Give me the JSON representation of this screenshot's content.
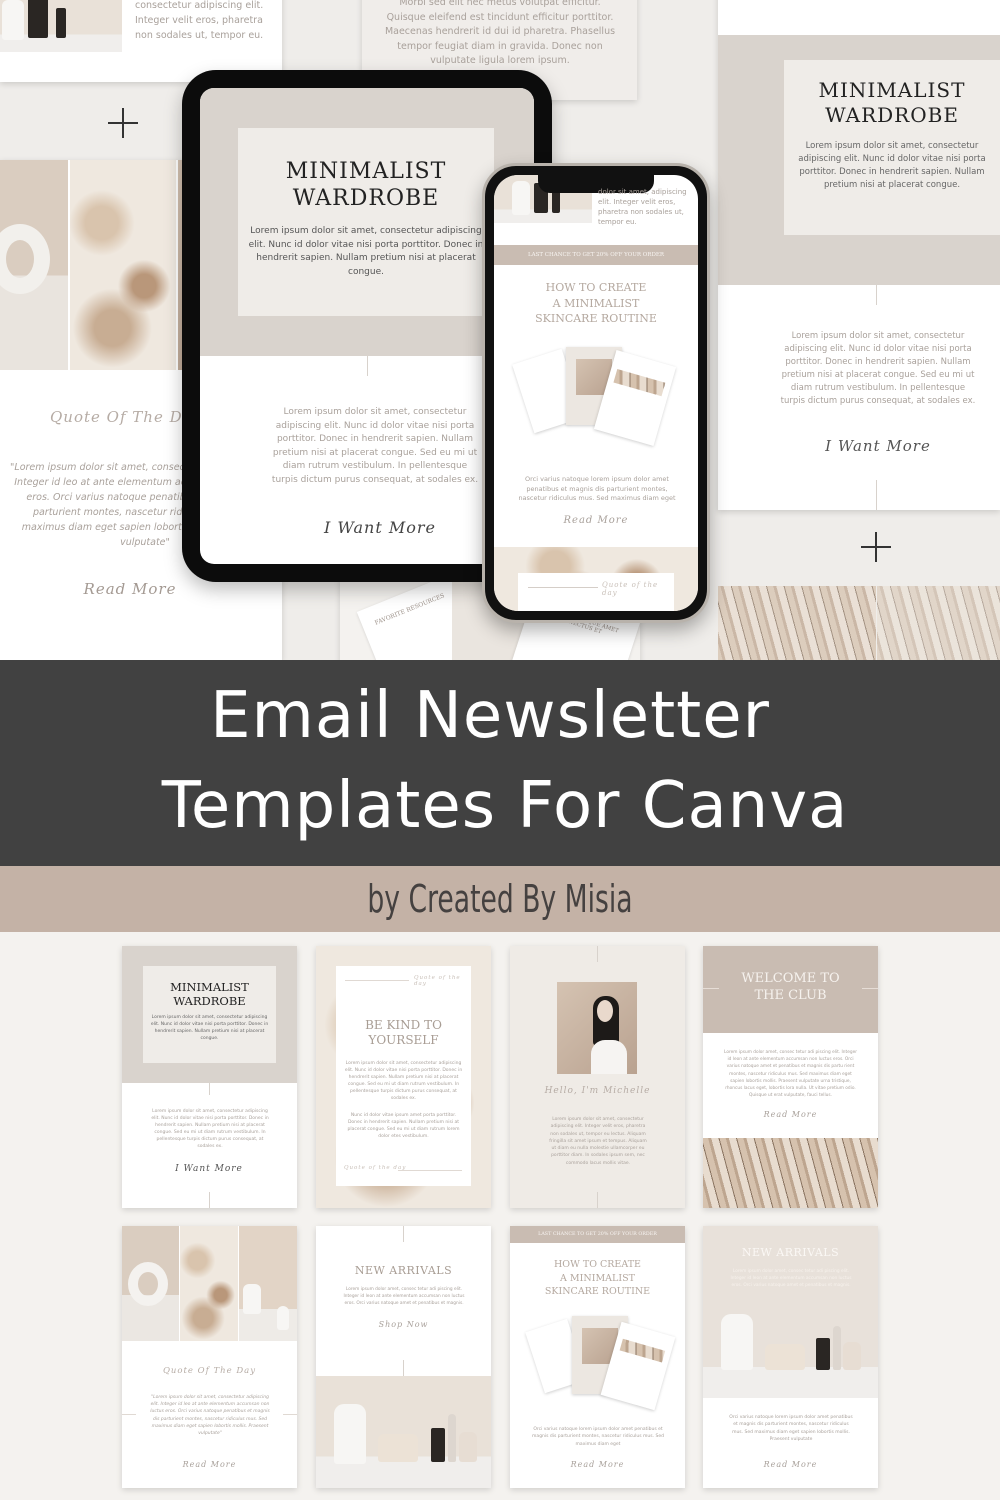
{
  "background_mockups": {
    "top_left_card": {
      "text": "consectetur adipiscing elit. Integer velit eros, pharetra non sodales ut, tempor eu."
    },
    "top_center_card": {
      "text": "Morbi sed elit nec metus volutpat efficitur. Quisque eleifend est tincidunt efficitur porttitor. Maecenas hendrerit id dui id pharetra. Phasellus tempor feugiat diam in gravida. Donec non vulputate ligula lorem ipsum."
    },
    "left_quote_card": {
      "heading": "Quote Of The Day",
      "body": "\"Lorem ipsum dolor sit amet, consectetur adipiscing elit. Integer id leo at ante elementum accumsan non luctus eros. Orci varius natoque penatibus et magnis dis parturient montes, nascetur ridiculus mus. Sed maximus diam eget sapien lobortis mollis. Praesent vulputate\"",
      "cta": "Read More"
    },
    "right_card": {
      "title": "MINIMALIST\nWARDROBE",
      "intro": "Lorem ipsum dolor sit amet, consectetur adipiscing elit. Nunc id dolor vitae nisi porta porttitor. Donec in hendrerit sapien. Nullam pretium nisi at placerat congue.",
      "body": "Lorem ipsum dolor sit amet, consectetur adipiscing elit. Nunc id dolor vitae nisi porta porttitor. Donec in hendrerit sapien. Nullam pretium nisi at placerat congue. Sed eu mi ut diam rutrum vestibulum. In pellentesque turpis dictum purus consequat, at sodales ex.",
      "cta": "I Want More"
    },
    "bottom_center_papers": {
      "paper_1": "FAVORITE RESOURCES",
      "paper_2": "MORBI TRISTIQUE AMET SENECTUS ET"
    }
  },
  "tablet": {
    "title": "MINIMALIST\nWARDROBE",
    "intro": "Lorem ipsum dolor sit amet, consectetur adipiscing elit. Nunc id dolor vitae nisi porta porttitor. Donec in hendrerit sapien. Nullam pretium nisi at placerat congue.",
    "body": "Lorem ipsum dolor sit amet, consectetur adipiscing elit. Nunc id dolor vitae nisi porta porttitor. Donec in hendrerit sapien. Nullam pretium nisi at placerat congue. Sed eu mi ut diam rutrum vestibulum. In pellentesque turpis dictum purus consequat, at sodales ex.",
    "cta": "I Want More"
  },
  "phone": {
    "top_text": "dolor sit amet, adipiscing elit. Integer velit eros, pharetra non sodales ut, tempor eu.",
    "banner": "LAST CHANCE TO GET 20% OFF YOUR ORDER",
    "title": "HOW TO CREATE\nA MINIMALIST\nSKINCARE ROUTINE",
    "body": "Orci varius natoque lorem ipsum dolor amet penatibus et magnis dis parturient montes, nascetur ridiculus mus. Sed maximus diam eget",
    "cta": "Read More",
    "quote_label": "Quote of the day"
  },
  "banner": {
    "title_line1": "Email Newsletter",
    "title_line2": "Templates For Canva",
    "subtitle": "by Created By Misia",
    "colors": {
      "dark": "#414141",
      "accent": "#c4b2a6"
    }
  },
  "templates": [
    {
      "id": "minimalist-wardrobe",
      "title": "MINIMALIST\nWARDROBE",
      "intro": "Lorem ipsum dolor sit amet, consectetur adipiscing elit. Nunc id dolor vitae nisi porta porttitor. Donec in hendrerit sapien. Nullam pretium nisi at placerat congue.",
      "body": "Lorem ipsum dolor sit amet, consectetur adipiscing elit. Nunc id dolor vitae nisi porta porttitor. Donec in hendrerit sapien. Nullam pretium nisi at placerat congue. Sed eu mi ut diam rutrum vestibulum. In pellentesque turpis dictum purus consequat, at sodales ex.",
      "cta": "I Want More"
    },
    {
      "id": "be-kind",
      "label_top": "Quote of the day",
      "title": "BE KIND TO\nYOURSELF",
      "body1": "Lorem ipsum dolor sit amet, consectetur adipiscing elit. Nunc id dolor vitae nisi porta porttitor. Donec in hendrerit sapien. Nullam pretium nisi at placerat congue. Sed eu mi ut diam rutrum vestibulum. In pellentesque turpis dictum purus consequat, at sodales ex.",
      "body2": "Nunc id dolor vitae ipsum amet porta porttitor. Donec in hendrerit sapien. Nullam pretium nisi at placerat congue. Sed eu mi ut diam rutrum lorem dolor etes vestibulum.",
      "label_bottom": "Quote of the day"
    },
    {
      "id": "hello-michelle",
      "heading": "Hello, I'm Michelle",
      "body": "Lorem ipsum dolor sit amet, consectetur adipiscing elit. Integer velit eros, pharetra non sodales ut, tempor eu lectus. Aliquam fringilla sit amet ipsum et tempus. Aliquam ut diam eu nulla molestie ullamcorper eu porttitor diam. In sodales ipsum sem, nec commodo lacus mollis vitae."
    },
    {
      "id": "welcome-club",
      "title": "WELCOME TO\nTHE CLUB",
      "body": "Lorem ipsum dolor amet, consec tetur adi piscing elit. Integer id leon at ante elementum accumsan non luctus eros. Orci varius natoque amet et penatibus et magnis dis partu rient montes, nascetur ridiculus mus. Sed maximus diam eget sapien lobortis mollis. Praesent vulputate urna tristique, rhoncus lacus eget, lobortis lora nulla. Ut vitae pretium odio. Quisque ut erat vulputate, fauci tellus.",
      "cta": "Read More"
    },
    {
      "id": "quote-of-day",
      "heading": "Quote Of The Day",
      "body": "\"Lorem ipsum dolor sit amet, consectetur adipiscing elit. Integer id leo at ante elementum accumsan non luctus eros. Orci varius natoque penatibus et magnis dis parturient montes, nascetur ridiculus mus. Sed maximus diam eget sapien lobortis mollis. Praesent vulputate\"",
      "cta": "Read More"
    },
    {
      "id": "new-arrivals-white",
      "title": "NEW ARRIVALS",
      "body": "Lorem ipsum dolor amet, consec tetur adi piscing elit. Integer id leon at ante elementum accumsan non luctus eros. Orci varius natoque amet et penatibus et magnis.",
      "cta": "Shop Now"
    },
    {
      "id": "skincare-routine",
      "banner": "LAST CHANCE TO GET 20% OFF YOUR ORDER",
      "title": "HOW TO CREATE\nA MINIMALIST\nSKINCARE ROUTINE",
      "body": "Orci varius natoque lorem ipsum dolor amet penatibus et magnis dis parturient montes, nascetur ridiculus mus. Sed maximus diam eget",
      "cta": "Read More"
    },
    {
      "id": "new-arrivals-beige",
      "title": "NEW ARRIVALS",
      "intro": "Lorem ipsum dolor amet, consec tetur adi piscing elit. Integer id leon at ante elementum accumsan non luctus eros. Orci varius natoque amet et penatibus et magnis.",
      "body": "Orci varius natoque lorem ipsum dolor amet penatibus et magnis dis parturient montes, nascetur ridiculus mus. Sed maximus diam eget sapien lobortis mollis. Praesent vulputate",
      "cta": "Read More"
    }
  ]
}
